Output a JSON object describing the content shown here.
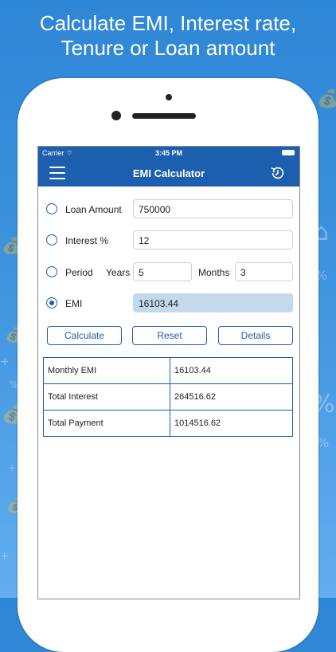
{
  "headline": {
    "line1": "Calculate EMI, Interest rate,",
    "line2": "Tenure or Loan amount"
  },
  "status": {
    "carrier": "Carrier",
    "time": "3:45 PM"
  },
  "nav": {
    "title": "EMI Calculator",
    "menu_icon": "hamburger-menu-icon",
    "history_icon": "history-icon"
  },
  "form": {
    "loan_amount": {
      "label": "Loan Amount",
      "value": "750000",
      "selected": false
    },
    "interest": {
      "label": "Interest %",
      "value": "12",
      "selected": false
    },
    "period": {
      "label": "Period",
      "years_label": "Years",
      "years_value": "5",
      "months_label": "Months",
      "months_value": "3",
      "selected": false
    },
    "emi": {
      "label": "EMI",
      "value": "16103.44",
      "selected": true
    }
  },
  "buttons": {
    "calculate": "Calculate",
    "reset": "Reset",
    "details": "Details"
  },
  "results": [
    {
      "label": "Monthly EMI",
      "value": "16103.44"
    },
    {
      "label": "Total Interest",
      "value": "264516.62"
    },
    {
      "label": "Total Payment",
      "value": "1014516.62"
    }
  ],
  "colors": {
    "accent": "#1c5fae",
    "emi_field_bg": "#c3d9ec",
    "background_top": "#2e86d6",
    "background_bottom": "#63aef0"
  }
}
